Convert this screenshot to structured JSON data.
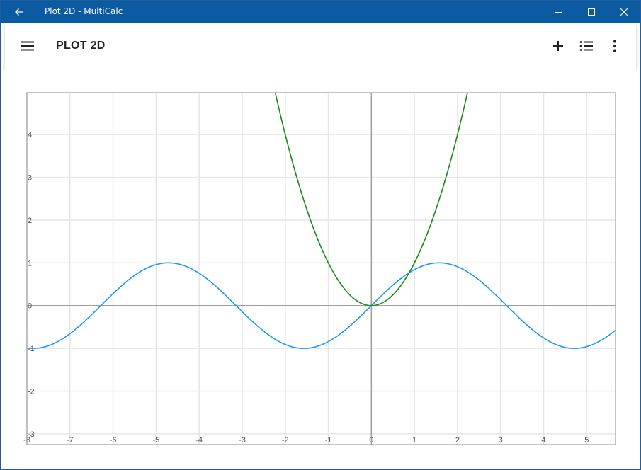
{
  "window": {
    "title": "Plot 2D - MultiCalc"
  },
  "appbar": {
    "title": "PLOT 2D"
  },
  "icons": {
    "back": "arrow-left-icon",
    "minimize": "minimize-icon",
    "maximize": "maximize-icon",
    "close": "close-icon",
    "menu": "hamburger-menu-icon",
    "add": "plus-icon",
    "list": "list-icon",
    "more": "more-vertical-icon"
  },
  "colors": {
    "titlebar": "#0b5aa2",
    "series_sin": "#2196f3",
    "series_x2": "#1a8a1a",
    "grid": "#e6e6e6",
    "axis": "#9e9e9e"
  },
  "chart_data": {
    "type": "line",
    "xlim": [
      -8,
      5.67
    ],
    "ylim": [
      -3.25,
      4.98
    ],
    "x_ticks": [
      -8,
      -7,
      -6,
      -5,
      -4,
      -3,
      -2,
      -1,
      0,
      1,
      2,
      3,
      4,
      5
    ],
    "y_ticks": [
      -3,
      -2,
      -1,
      0,
      1,
      2,
      3,
      4
    ],
    "grid": true,
    "series": [
      {
        "function": "sin(x)",
        "color": "#2196f3",
        "x_range": [
          -8,
          5.67
        ]
      },
      {
        "function": "x^2",
        "color": "#1a8a1a",
        "x_range": [
          -8,
          5.67
        ]
      }
    ]
  }
}
